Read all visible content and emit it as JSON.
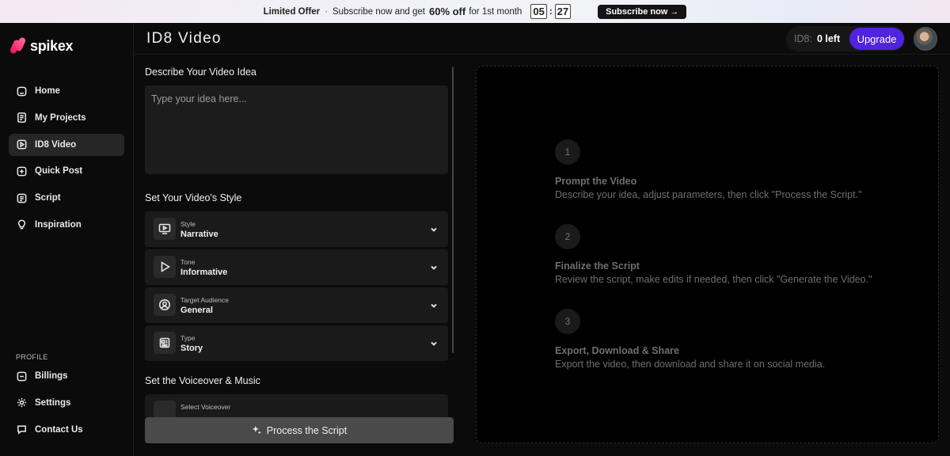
{
  "promo": {
    "offer_label": "Limited Offer",
    "separator": "·",
    "text_pre": "Subscribe now and get",
    "discount": "60% off",
    "text_post": "for 1st month",
    "countdown_min": "05",
    "countdown_sep": ":",
    "countdown_sec": "27",
    "cta": "Subscribe now →"
  },
  "brand": {
    "name": "spikex"
  },
  "sidebar": {
    "items": [
      {
        "label": "Home",
        "icon": "home-icon"
      },
      {
        "label": "My Projects",
        "icon": "projects-icon"
      },
      {
        "label": "ID8 Video",
        "icon": "video-icon",
        "active": true
      },
      {
        "label": "Quick Post",
        "icon": "quick-post-icon"
      },
      {
        "label": "Script",
        "icon": "script-icon"
      },
      {
        "label": "Inspiration",
        "icon": "lightbulb-icon"
      }
    ],
    "profile_label": "PROFILE",
    "profile_items": [
      {
        "label": "Billings",
        "icon": "billing-icon"
      },
      {
        "label": "Settings",
        "icon": "settings-icon"
      },
      {
        "label": "Contact Us",
        "icon": "chat-icon"
      }
    ]
  },
  "header": {
    "title": "ID8 Video",
    "credit_unit": "ID8:",
    "credits_left": "0 left",
    "upgrade": "Upgrade"
  },
  "form": {
    "idea_label": "Describe Your Video Idea",
    "idea_placeholder": "Type your idea here...",
    "style_label": "Set Your Video's Style",
    "options": [
      {
        "key": "Style",
        "value": "Narrative",
        "icon": "monitor-play-icon"
      },
      {
        "key": "Tone",
        "value": "Informative",
        "icon": "play-icon"
      },
      {
        "key": "Target Audience",
        "value": "General",
        "icon": "user-circle-icon"
      },
      {
        "key": "Type",
        "value": "Story",
        "icon": "newspaper-icon"
      }
    ],
    "voice_label": "Set the Voiceover & Music",
    "voice_option_key": "Select Voiceover",
    "process_button": "Process the Script"
  },
  "steps": [
    {
      "num": "1",
      "title": "Prompt the Video",
      "desc": "Describe your idea, adjust parameters, then click \"Process the Script.\""
    },
    {
      "num": "2",
      "title": "Finalize the Script",
      "desc": "Review the script, make edits if needed, then click \"Generate the Video.\""
    },
    {
      "num": "3",
      "title": "Export, Download & Share",
      "desc": "Export the video, then download and share it on social media."
    }
  ],
  "colors": {
    "accent": "#4f23e0",
    "brand": "#ff2d6a"
  }
}
